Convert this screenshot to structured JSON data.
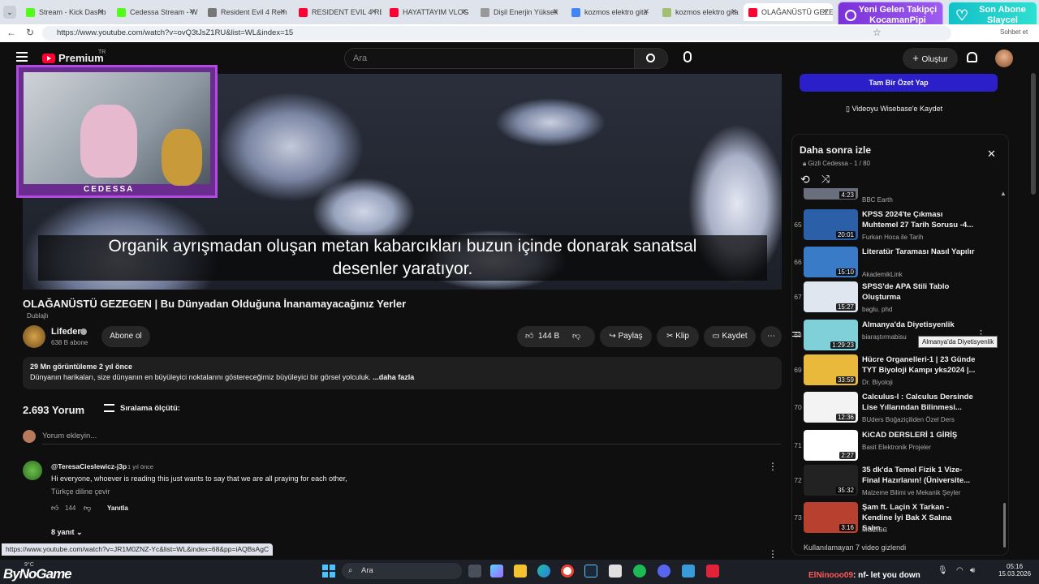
{
  "browser": {
    "tabs": [
      {
        "label": "Stream - Kick Dashb",
        "color": "#53fc18"
      },
      {
        "label": "Cedessa Stream - W",
        "color": "#53fc18"
      },
      {
        "label": "Resident Evil 4 Rem",
        "color": "#777777"
      },
      {
        "label": "RESIDENT EVIL 4 RE",
        "color": "#ff0033"
      },
      {
        "label": "HAYATTAYIM VLOG",
        "color": "#ff0033"
      },
      {
        "label": "Dişil Enerjin Yüksek",
        "color": "#999999"
      },
      {
        "label": "kozmos elektro gita",
        "color": "#4285f4"
      },
      {
        "label": "kozmos elektro gita",
        "color": "#a0c070"
      },
      {
        "label": "OLAĞANÜSTÜ GEZE",
        "color": "#ff0033"
      }
    ],
    "url": "https://www.youtube.com/watch?v=ovQ3tJsZ1RU&list=WL&index=15",
    "profile_label": "Sohbet et"
  },
  "alerts": {
    "follower_title": "Yeni Gelen Takipçi",
    "follower_name": "KocamanPipi",
    "sub_title": "Son Abone",
    "sub_name": "Slaycel"
  },
  "header": {
    "logo": "Premium",
    "logo_region": "TR",
    "search_placeholder": "Ara",
    "create_label": "Oluştur"
  },
  "player": {
    "subtitle_line1": "Organik ayrışmadan oluşan metan kabarcıkları buzun içinde donarak sanatsal",
    "subtitle_line2": "desenler yaratıyor.",
    "webcam_name": "CEDESSA"
  },
  "video": {
    "title": "OLAĞANÜSTÜ GEZEGEN | Bu Dünyadan Olduğuna İnanamayacağınız Yerler",
    "dubbed": "Dublajlı",
    "channel": "Lifeder",
    "subs": "638 B abone",
    "subscribe": "Abone ol",
    "likes": "144 B",
    "share": "Paylaş",
    "clip": "Klip",
    "save": "Kaydet",
    "views": "29 Mn görüntüleme  2 yıl önce",
    "description": "Dünyanın harikaları, size dünyanın en büyüleyici noktalarını göstereceğimiz büyüleyici bir görsel yolculuk.",
    "more": "...daha fazla"
  },
  "comments": {
    "count": "2.693 Yorum",
    "sort": "Sıralama ölçütü:",
    "add_placeholder": "Yorum ekleyin...",
    "first": {
      "author": "@TeresaCieslewicz-j3p",
      "time": "1 yıl önce",
      "text": "Hi everyone, whoever is reading this just wants to say that we are all praying for each other,",
      "translate": "Türkçe diline çevir",
      "likes": "144",
      "reply": "Yanıtla",
      "replies": "8 yanıt"
    }
  },
  "status_url": "https://www.youtube.com/watch?v=JR1M0ZNZ-Yc&list=WL&index=68&pp=iAQBsAgC",
  "side": {
    "summary_button": "Tam Bir Özet Yap",
    "save_wisebase": "Videoyu Wisebase'e Kaydet",
    "playlist_title": "Daha sonra izle",
    "playlist_meta": "Gizli  Cedessa - 1 / 80",
    "top_channel": "BBC Earth",
    "top_duration": "4:23",
    "tooltip": "Almanya'da Diyetisyenlik",
    "hidden_note": "Kullanılamayan 7 video gizlendi",
    "items": [
      {
        "num": "65",
        "title": "KPSS 2024'te Çıkması Muhtemel 27 Tarih Sorusu -4...",
        "channel": "Furkan Hoca ile Tarih",
        "duration": "20:01",
        "color": "#2b5fa8"
      },
      {
        "num": "66",
        "title": "Literatür Taraması Nasıl Yapılır",
        "channel": "AkademikLink",
        "duration": "15:10",
        "color": "#3a7bc8"
      },
      {
        "num": "67",
        "title": "SPSS'de APA Stili Tablo Oluşturma",
        "channel": "baglu. phd",
        "duration": "15:27",
        "color": "#dfe6ef"
      },
      {
        "num": "68",
        "title": "Almanya'da Diyetisyenlik",
        "channel": "biaraştırmabisu",
        "duration": "1:29:23",
        "color": "#7fd0d8"
      },
      {
        "num": "69",
        "title": "Hücre Organelleri-1 | 23 Günde TYT Biyoloji Kampı yks2024 |...",
        "channel": "Dr. Biyoloji",
        "duration": "33:59",
        "color": "#e8b93a"
      },
      {
        "num": "70",
        "title": "Calculus-I : Calculus Dersinde Lise Yıllarından Bilinmesi...",
        "channel": "BUders Boğaziçiliden Özel Ders",
        "duration": "12:36",
        "color": "#f3f3f3"
      },
      {
        "num": "71",
        "title": "KiCAD DERSLERİ 1 GİRİŞ",
        "channel": "Basit Elektronik Projeler",
        "duration": "2:27",
        "color": "#ffffff"
      },
      {
        "num": "72",
        "title": "35 dk'da Temel Fizik 1 Vize-Final Hazırlanın! (Üniversite...",
        "channel": "Malzeme Bilimi ve Mekanik Şeyler",
        "duration": "35:32",
        "color": "#222222"
      },
      {
        "num": "73",
        "title": "Şam ft. Laçin X Tarkan - Kendine İyi Bak X Salına Salın...",
        "channel": "MOZISC",
        "duration": "3:16",
        "color": "#b8402e"
      }
    ]
  },
  "taskbar": {
    "weather": "9°C",
    "brand": "ByNoGame",
    "search": "Ara",
    "ticker_user": "ElNinooo09",
    "ticker_msg": ": nf- let you down",
    "time": "05:16",
    "date": "15.03.2026"
  }
}
